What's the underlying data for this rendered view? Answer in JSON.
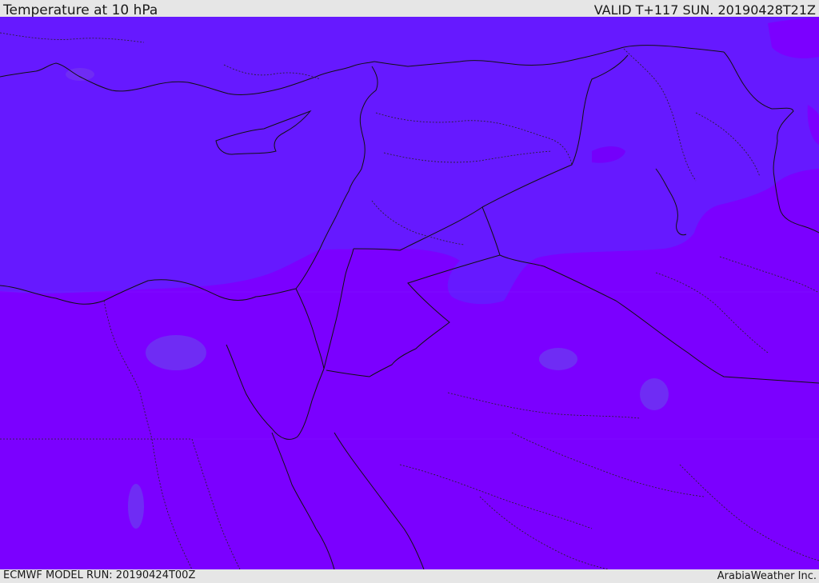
{
  "header": {
    "title": "Temperature at 10 hPa",
    "valid_time": "VALID T+117 SUN. 20190428T21Z"
  },
  "footer": {
    "model_run": "ECMWF MODEL RUN: 20190424T00Z",
    "credit": "ArabiaWeather Inc."
  },
  "map": {
    "colors": {
      "cold_band": "#6619ff",
      "warm_band": "#7b00ff",
      "patch": "#6f2cf4",
      "border_line": "#111111"
    },
    "fields": [
      {
        "name": "northern-temperature-band",
        "color": "#6619ff"
      },
      {
        "name": "southern-temperature-band",
        "color": "#7b00ff"
      }
    ]
  }
}
